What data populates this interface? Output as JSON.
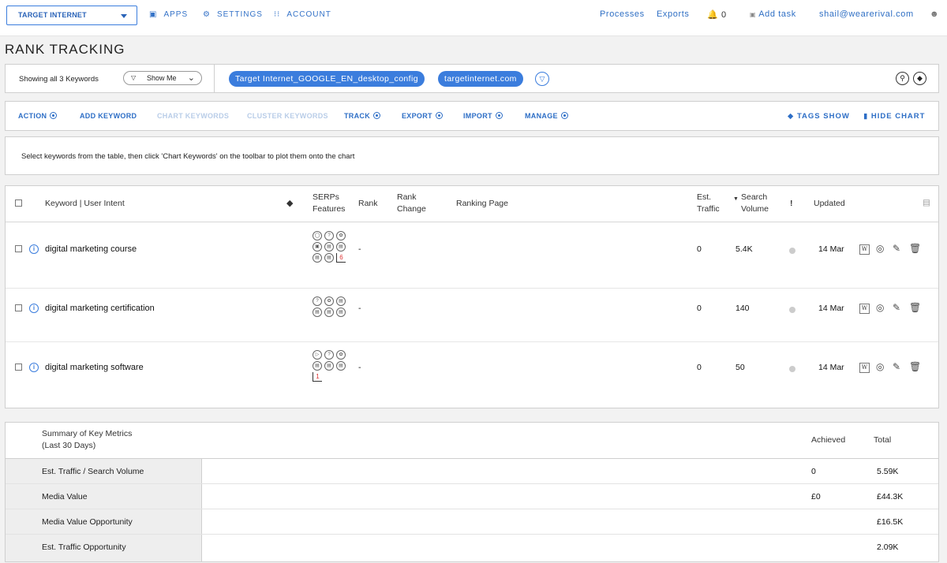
{
  "topbar": {
    "project": "TARGET INTERNET",
    "nav": [
      {
        "label": "APPS",
        "icon": "apps-icon"
      },
      {
        "label": "SETTINGS",
        "icon": "gear-icon"
      },
      {
        "label": "ACCOUNT",
        "icon": "sliders-icon"
      }
    ],
    "processes": "Processes",
    "exports": "Exports",
    "notifications_count": "0",
    "add_task": "Add task",
    "user_email": "shail@wearerival.com"
  },
  "page_title": "RANK TRACKING",
  "filterbar": {
    "showing": "Showing all 3 Keywords",
    "show_me": "Show Me",
    "chips": [
      "Target Internet_GOOGLE_EN_desktop_config",
      "targetinternet.com"
    ]
  },
  "toolbar": {
    "left": [
      {
        "label": "ACTION",
        "dropdown": true,
        "disabled": false
      },
      {
        "label": "ADD KEYWORD",
        "dropdown": false,
        "disabled": false
      },
      {
        "label": "CHART KEYWORDS",
        "dropdown": false,
        "disabled": true
      },
      {
        "label": "CLUSTER KEYWORDS",
        "dropdown": false,
        "disabled": true
      },
      {
        "label": "TRACK",
        "dropdown": true,
        "disabled": false
      },
      {
        "label": "EXPORT",
        "dropdown": true,
        "disabled": false
      },
      {
        "label": "IMPORT",
        "dropdown": true,
        "disabled": false
      },
      {
        "label": "MANAGE",
        "dropdown": true,
        "disabled": false
      }
    ],
    "tags_show": "TAGS SHOW",
    "hide_chart": "HIDE CHART"
  },
  "hint": "Select keywords from the table, then click 'Chart Keywords' on the toolbar to plot them onto the chart",
  "table": {
    "headers": {
      "keyword": "Keyword | User Intent",
      "serps": "SERPs Features",
      "rank": "Rank",
      "rank_change": "Rank Change",
      "ranking_page": "Ranking Page",
      "est_traffic": "Est. Traffic",
      "search_volume": "Search Volume",
      "alert": "!",
      "updated": "Updated"
    },
    "rows": [
      {
        "keyword": "digital marketing course",
        "rank": "-",
        "est_traffic": "0",
        "search_volume": "5.4K",
        "updated": "14 Mar",
        "serp_icons": [
          "map-pin-icon",
          "question-icon",
          "leaf-icon",
          "image-icon",
          "list-icon",
          "list-icon",
          "list-icon",
          "list-icon"
        ],
        "serp_more": "6"
      },
      {
        "keyword": "digital marketing certification",
        "rank": "-",
        "est_traffic": "0",
        "search_volume": "140",
        "updated": "14 Mar",
        "serp_icons": [
          "question-icon",
          "leaf-icon",
          "list-icon",
          "list-icon",
          "list-icon",
          "list-icon"
        ],
        "serp_more": ""
      },
      {
        "keyword": "digital marketing software",
        "rank": "-",
        "est_traffic": "0",
        "search_volume": "50",
        "updated": "14 Mar",
        "serp_icons": [
          "play-icon",
          "question-icon",
          "leaf-icon",
          "list-icon",
          "list-icon",
          "list-icon"
        ],
        "serp_more": "1"
      }
    ]
  },
  "summary": {
    "title": "Summary of Key Metrics",
    "subtitle": "(Last 30 Days)",
    "achieved_label": "Achieved",
    "total_label": "Total",
    "rows": [
      {
        "label": "Est. Traffic / Search Volume",
        "achieved": "0",
        "total": "5.59K"
      },
      {
        "label": "Media Value",
        "achieved": "£0",
        "total": "£44.3K"
      },
      {
        "label": "Media Value Opportunity",
        "achieved": "",
        "total": "£16.5K"
      },
      {
        "label": "Est. Traffic Opportunity",
        "achieved": "",
        "total": "2.09K"
      }
    ]
  }
}
